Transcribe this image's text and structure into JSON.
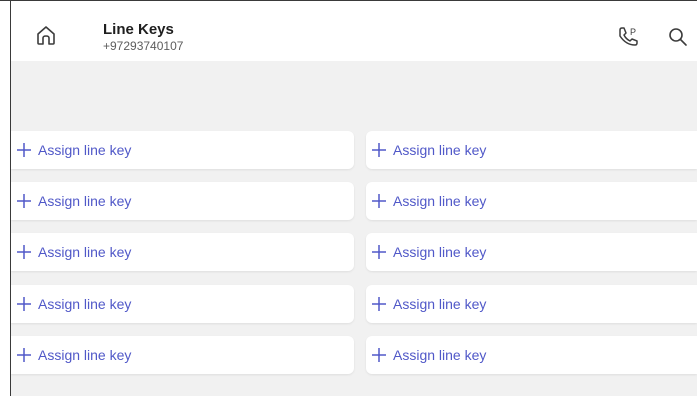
{
  "header": {
    "title": "Line Keys",
    "phone_number": "+97293740107",
    "home_icon": "home-icon",
    "park_call_icon": "call-park-icon",
    "search_icon": "search-icon"
  },
  "colors": {
    "accent": "#5058c8",
    "background": "#f1f1f1",
    "card": "#ffffff"
  },
  "line_keys": {
    "left": [
      {
        "label": "Assign line key",
        "icon": "plus-icon"
      },
      {
        "label": "Assign line key",
        "icon": "plus-icon"
      },
      {
        "label": "Assign line key",
        "icon": "plus-icon"
      },
      {
        "label": "Assign line key",
        "icon": "plus-icon"
      },
      {
        "label": "Assign line key",
        "icon": "plus-icon"
      }
    ],
    "right": [
      {
        "label": "Assign line key",
        "icon": "plus-icon"
      },
      {
        "label": "Assign line key",
        "icon": "plus-icon"
      },
      {
        "label": "Assign line key",
        "icon": "plus-icon"
      },
      {
        "label": "Assign line key",
        "icon": "plus-icon"
      },
      {
        "label": "Assign line key",
        "icon": "plus-icon"
      }
    ]
  }
}
